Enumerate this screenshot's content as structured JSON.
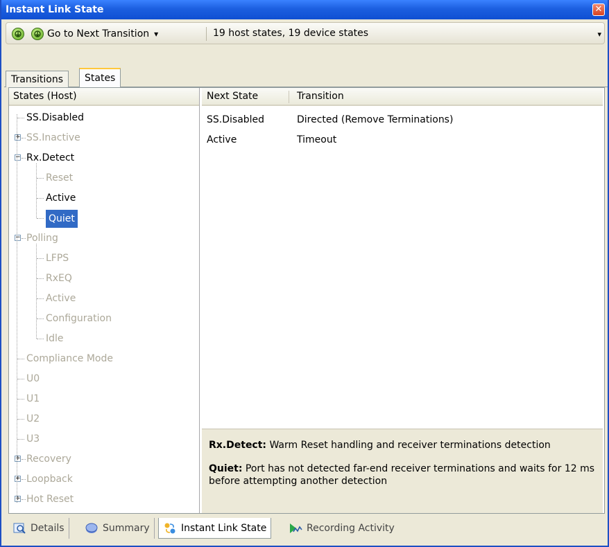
{
  "window": {
    "title": "Instant Link State",
    "close_glyph": "✕"
  },
  "toolbar": {
    "back_icon": "go-previous-icon",
    "next_icon": "go-next-icon",
    "next_label": "Go to Next Transition",
    "dropdown_glyph": "▾",
    "status": "19 host states, 19 device states",
    "overflow_glyph": "▾"
  },
  "tabs": [
    {
      "label": "Transitions",
      "active": false
    },
    {
      "label": "States",
      "active": true
    }
  ],
  "tree": {
    "header": "States (Host)",
    "nodes": [
      {
        "label": "SS.Disabled",
        "dim": false
      },
      {
        "label": "SS.Inactive",
        "dim": true,
        "toggle": "+"
      },
      {
        "label": "Rx.Detect",
        "dim": false,
        "toggle": "−"
      },
      {
        "label": "Reset",
        "dim": true
      },
      {
        "label": "Active",
        "dim": false
      },
      {
        "label": "Quiet",
        "dim": false,
        "selected": true
      },
      {
        "label": "Polling",
        "dim": true,
        "toggle": "−"
      },
      {
        "label": "LFPS",
        "dim": true
      },
      {
        "label": "RxEQ",
        "dim": true
      },
      {
        "label": "Active",
        "dim": true
      },
      {
        "label": "Configuration",
        "dim": true
      },
      {
        "label": "Idle",
        "dim": true
      },
      {
        "label": "Compliance Mode",
        "dim": true
      },
      {
        "label": "U0",
        "dim": true
      },
      {
        "label": "U1",
        "dim": true
      },
      {
        "label": "U2",
        "dim": true
      },
      {
        "label": "U3",
        "dim": true
      },
      {
        "label": "Recovery",
        "dim": true,
        "toggle": "+"
      },
      {
        "label": "Loopback",
        "dim": true,
        "toggle": "+"
      },
      {
        "label": "Hot Reset",
        "dim": true,
        "toggle": "+"
      }
    ]
  },
  "grid": {
    "columns": [
      "Next State",
      "Transition"
    ],
    "rows": [
      [
        "SS.Disabled",
        "Directed (Remove Terminations)"
      ],
      [
        "Active",
        "Timeout"
      ]
    ]
  },
  "description": {
    "state_name": "Rx.Detect:",
    "state_text": " Warm Reset handling and receiver terminations detection",
    "substate_name": "Quiet:",
    "substate_text": " Port has not detected far-end receiver terminations and waits for 12 ms before attempting another detection"
  },
  "bottom_tabs": [
    {
      "label": "Details",
      "icon": "details-icon",
      "active": false
    },
    {
      "label": "Summary",
      "icon": "summary-icon",
      "active": false
    },
    {
      "label": "Instant Link State",
      "icon": "instant-link-state-icon",
      "active": true
    },
    {
      "label": "Recording Activity",
      "icon": "recording-activity-icon",
      "active": false
    }
  ],
  "colors": {
    "title_bar": "#1c5fe0",
    "selection": "#316ac5",
    "active_tab_accent": "#ffc83c",
    "dim_text": "#aca899"
  }
}
